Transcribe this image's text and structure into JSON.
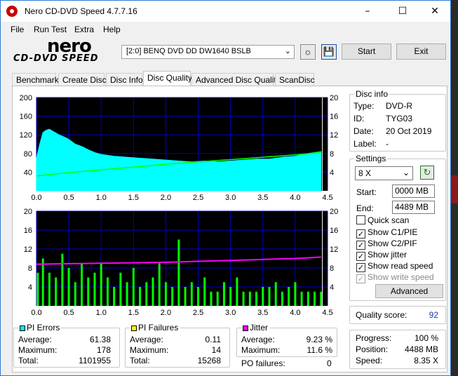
{
  "window": {
    "title": "Nero CD-DVD Speed 4.7.7.16"
  },
  "menu": {
    "file": "File",
    "run_test": "Run Test",
    "extra": "Extra",
    "help": "Help"
  },
  "logo": {
    "brand": "nero",
    "product": "CD-DVD SPEED"
  },
  "toolbar": {
    "drive": "[2:0]   BENQ DVD DD DW1640 BSLB",
    "start": "Start",
    "exit": "Exit"
  },
  "tabs": [
    "Benchmark",
    "Create Disc",
    "Disc Info",
    "Disc Quality",
    "Advanced Disc Quality",
    "ScanDisc"
  ],
  "disc_info": {
    "title": "Disc info",
    "type_label": "Type:",
    "type": "DVD-R",
    "id_label": "ID:",
    "id": "TYG03",
    "date_label": "Date:",
    "date": "20 Oct 2019",
    "label_label": "Label:",
    "label": "-"
  },
  "settings": {
    "title": "Settings",
    "speed": "8 X",
    "start_label": "Start:",
    "start": "0000 MB",
    "end_label": "End:",
    "end": "4489 MB",
    "quick_scan": "Quick scan",
    "show_c1": "Show C1/PIE",
    "show_c2": "Show C2/PIF",
    "show_jitter": "Show jitter",
    "show_read": "Show read speed",
    "show_write": "Show write speed",
    "advanced": "Advanced"
  },
  "quality": {
    "label": "Quality score:",
    "value": "92"
  },
  "progress": {
    "progress_label": "Progress:",
    "progress": "100 %",
    "position_label": "Position:",
    "position": "4488 MB",
    "speed_label": "Speed:",
    "speed": "8.35 X"
  },
  "pi_errors": {
    "title": "PI Errors",
    "avg_label": "Average:",
    "avg": "61.38",
    "max_label": "Maximum:",
    "max": "178",
    "total_label": "Total:",
    "total": "1101955"
  },
  "pi_failures": {
    "title": "PI Failures",
    "avg_label": "Average:",
    "avg": "0.11",
    "max_label": "Maximum:",
    "max": "14",
    "total_label": "Total:",
    "total": "15268"
  },
  "jitter": {
    "title": "Jitter",
    "avg_label": "Average:",
    "avg": "9.23 %",
    "max_label": "Maximum:",
    "max": "11.6 %",
    "po_label": "PO failures:",
    "po": "0"
  },
  "colors": {
    "pi_errors": "#00ffff",
    "pi_failures": "#ffff00",
    "jitter": "#ff00ff",
    "read_speed": "#00ff00",
    "plot_bg": "#000000",
    "grid": "#0000cc"
  },
  "chart_data": [
    {
      "type": "area",
      "name": "pi-errors-chart",
      "x_ticks": [
        "0.0",
        "0.5",
        "1.0",
        "1.5",
        "2.0",
        "2.5",
        "3.0",
        "3.5",
        "4.0",
        "4.5"
      ],
      "y_ticks_left": [
        "40",
        "80",
        "120",
        "160",
        "200"
      ],
      "y_ticks_right": [
        "4",
        "8",
        "12",
        "16",
        "20"
      ],
      "xlim": [
        0,
        4.5
      ],
      "ylim": [
        0,
        200
      ],
      "y2lim": [
        0,
        20
      ],
      "series": [
        {
          "name": "PI Errors",
          "kind": "area",
          "x": [
            0.0,
            0.05,
            0.1,
            0.15,
            0.2,
            0.25,
            0.3,
            0.35,
            0.4,
            0.45,
            0.5,
            0.55,
            0.6,
            0.7,
            0.8,
            0.9,
            1.0,
            1.2,
            1.4,
            1.6,
            1.8,
            2.0,
            2.2,
            2.4,
            2.6,
            2.8,
            3.0,
            3.2,
            3.4,
            3.6,
            3.8,
            4.0,
            4.2,
            4.4
          ],
          "y": [
            70,
            100,
            125,
            130,
            132,
            128,
            124,
            120,
            117,
            114,
            110,
            105,
            100,
            95,
            88,
            82,
            78,
            74,
            72,
            70,
            68,
            66,
            64,
            62,
            64,
            62,
            64,
            66,
            68,
            68,
            72,
            74,
            80,
            84
          ]
        },
        {
          "name": "Read speed",
          "kind": "line",
          "x": [
            0.0,
            0.5,
            1.0,
            1.5,
            2.0,
            2.5,
            3.0,
            3.5,
            4.0,
            4.4
          ],
          "y": [
            3.2,
            3.9,
            4.5,
            5.1,
            5.7,
            6.2,
            6.7,
            7.2,
            7.7,
            8.2
          ]
        }
      ]
    },
    {
      "type": "bar",
      "name": "pi-failures-chart",
      "x_ticks": [
        "0.0",
        "0.5",
        "1.0",
        "1.5",
        "2.0",
        "2.5",
        "3.0",
        "3.5",
        "4.0",
        "4.5"
      ],
      "y_ticks_left": [
        "4",
        "8",
        "12",
        "16",
        "20"
      ],
      "y_ticks_right": [
        "4",
        "8",
        "12",
        "16",
        "20"
      ],
      "xlim": [
        0,
        4.5
      ],
      "ylim": [
        0,
        20
      ],
      "y2lim": [
        0,
        20
      ],
      "series": [
        {
          "name": "PI Failures",
          "kind": "bar",
          "x": [
            0.02,
            0.1,
            0.2,
            0.3,
            0.4,
            0.5,
            0.6,
            0.7,
            0.8,
            0.9,
            1.0,
            1.1,
            1.2,
            1.3,
            1.4,
            1.5,
            1.6,
            1.7,
            1.8,
            1.9,
            2.0,
            2.1,
            2.2,
            2.3,
            2.4,
            2.5,
            2.6,
            2.7,
            2.8,
            2.9,
            3.0,
            3.1,
            3.2,
            3.3,
            3.4,
            3.5,
            3.6,
            3.7,
            3.8,
            3.9,
            4.0,
            4.1,
            4.2,
            4.3,
            4.4
          ],
          "y": [
            7,
            10,
            7,
            6,
            11,
            8,
            5,
            9,
            6,
            7,
            9,
            6,
            4,
            7,
            5,
            8,
            4,
            5,
            6,
            9,
            5,
            4,
            14,
            4,
            5,
            4,
            6,
            3,
            3,
            5,
            4,
            6,
            3,
            3,
            3,
            4,
            4,
            5,
            3,
            4,
            5,
            3,
            3,
            3,
            3
          ]
        },
        {
          "name": "Jitter",
          "kind": "line",
          "x": [
            0.0,
            0.5,
            1.0,
            1.5,
            2.0,
            2.5,
            3.0,
            3.5,
            4.0,
            4.4
          ],
          "y": [
            8.8,
            8.9,
            9.0,
            9.1,
            9.2,
            9.4,
            9.6,
            9.8,
            10.0,
            10.3
          ]
        }
      ]
    }
  ]
}
